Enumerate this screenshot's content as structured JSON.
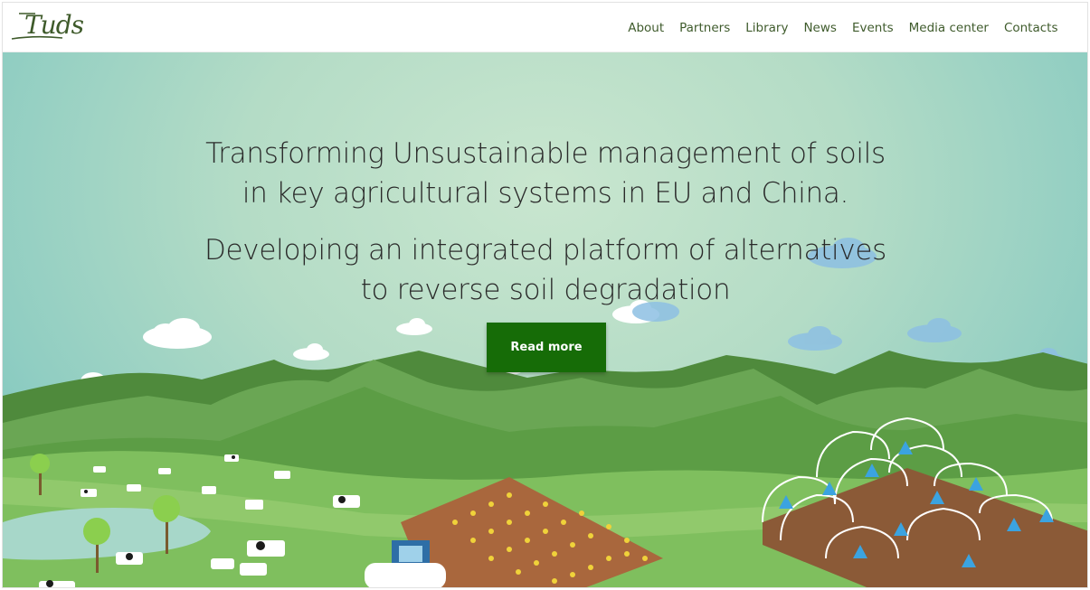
{
  "logo": {
    "text": "Tuds"
  },
  "nav": {
    "items": [
      "About",
      "Partners",
      "Library",
      "News",
      "Events",
      "Media center",
      "Contacts"
    ]
  },
  "hero": {
    "headline_line1": "Transforming Unsustainable management of soils",
    "headline_line2": "in key agricultural systems in EU and China.",
    "subline_line1": "Developing an integrated platform of alternatives",
    "subline_line2": "to reverse soil degradation",
    "cta_label": "Read more"
  },
  "colors": {
    "brand_green": "#166c07",
    "nav_text": "#3f5b2c",
    "sky": "#b4dcc6"
  }
}
